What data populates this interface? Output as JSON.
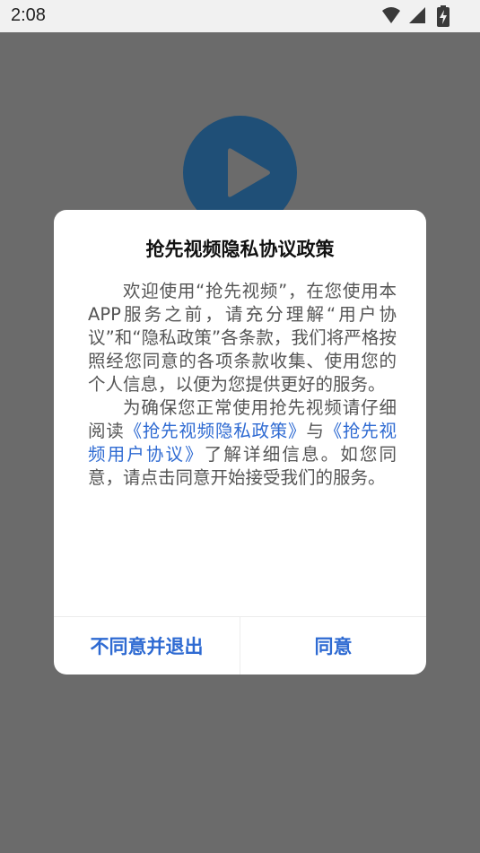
{
  "status_bar": {
    "time": "2:08",
    "icons": [
      "wifi-icon",
      "cellular-signal-icon",
      "battery-charging-icon"
    ]
  },
  "background": {
    "overlay_color": "#6b6b6b",
    "play_button_icon": "play-icon"
  },
  "dialog": {
    "title": "抢先视频隐私协议政策",
    "paragraph1": "欢迎使用“抢先视频”，在您使用本APP服务之前，请充分理解“用户协议”和“隐私政策”各条款，我们将严格按照经您同意的各项条款收集、使用您的个人信息，以便为您提供更好的服务。",
    "paragraph2_prefix": "为确保您正常使用抢先视频请仔细阅读",
    "privacy_link": "《抢先视频隐私政策》",
    "paragraph2_and": "与",
    "agreement_link": "《抢先视频用户协议》",
    "paragraph2_suffix": "了解详细信息。如您同意，请点击同意开始接受我们的服务。",
    "decline_label": "不同意并退出",
    "agree_label": "同意"
  },
  "colors": {
    "accent": "#2e6ad2",
    "play_circle": "#1f4f77"
  }
}
